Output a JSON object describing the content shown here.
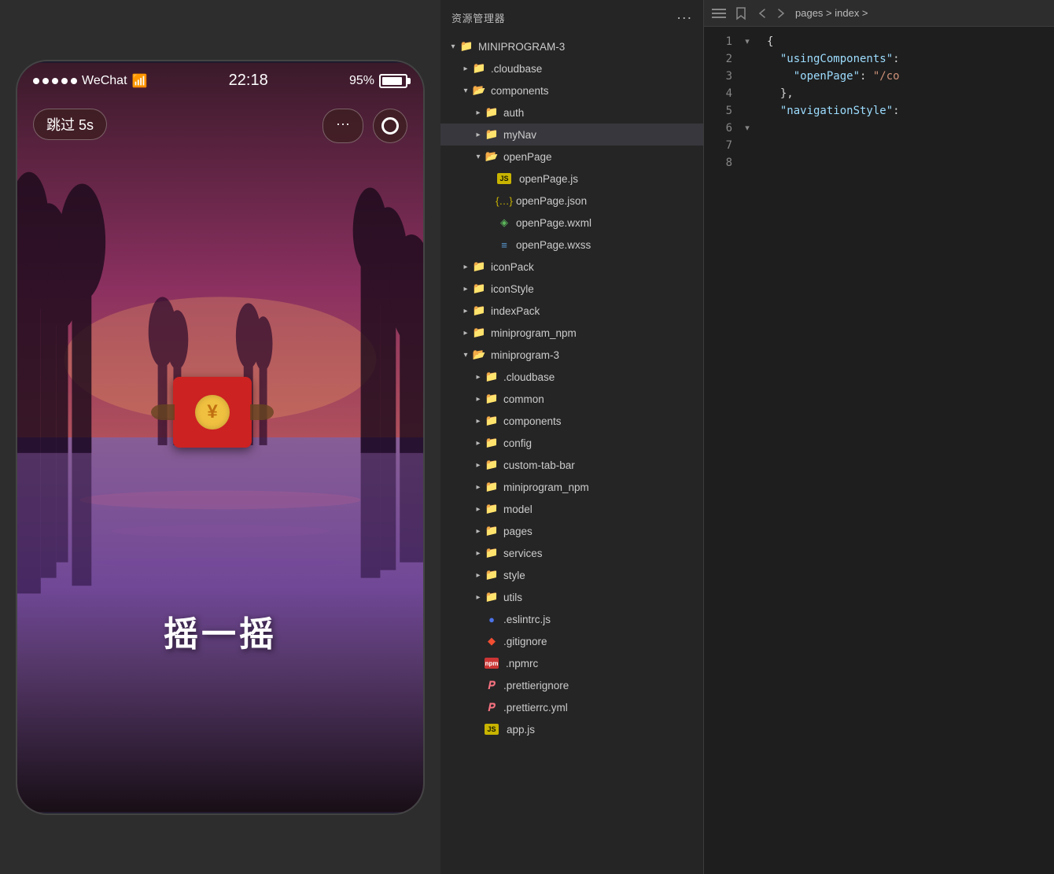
{
  "phone": {
    "status": {
      "dots": [
        1,
        2,
        3,
        4,
        5
      ],
      "app_name": "WeChat",
      "wifi_icon": "wifi",
      "time": "22:18",
      "battery_pct": "95%"
    },
    "skip_btn": "跳过 5s",
    "more_btn": "···",
    "shake_text": "摇一摇",
    "envelope": {
      "yuan_symbol": "¥"
    }
  },
  "explorer": {
    "title": "资源管理器",
    "menu_dots": "···",
    "root": "MINIPROGRAM-3",
    "items": [
      {
        "id": "cloudbase-root",
        "level": 1,
        "type": "folder-closed",
        "color": "blue",
        "label": ".cloudbase"
      },
      {
        "id": "components-root",
        "level": 1,
        "type": "folder-open",
        "color": "yellow",
        "label": "components"
      },
      {
        "id": "auth",
        "level": 2,
        "type": "folder-closed",
        "color": "yellow",
        "label": "auth"
      },
      {
        "id": "myNav",
        "level": 2,
        "type": "folder-closed",
        "color": "yellow",
        "label": "myNav",
        "active": true
      },
      {
        "id": "openPage",
        "level": 2,
        "type": "folder-open",
        "color": "yellow",
        "label": "openPage"
      },
      {
        "id": "openPage-js",
        "level": 3,
        "type": "file",
        "icon": "js",
        "label": "openPage.js"
      },
      {
        "id": "openPage-json",
        "level": 3,
        "type": "file",
        "icon": "json",
        "label": "openPage.json"
      },
      {
        "id": "openPage-wxml",
        "level": 3,
        "type": "file",
        "icon": "wxml",
        "label": "openPage.wxml"
      },
      {
        "id": "openPage-wxss",
        "level": 3,
        "type": "file",
        "icon": "wxss",
        "label": "openPage.wxss"
      },
      {
        "id": "iconPack",
        "level": 1,
        "type": "folder-closed",
        "color": "blue",
        "label": "iconPack"
      },
      {
        "id": "iconStyle",
        "level": 1,
        "type": "folder-closed",
        "color": "blue",
        "label": "iconStyle"
      },
      {
        "id": "indexPack",
        "level": 1,
        "type": "folder-closed",
        "color": "blue",
        "label": "indexPack"
      },
      {
        "id": "miniprogram-npm-root",
        "level": 1,
        "type": "folder-closed",
        "color": "blue",
        "label": "miniprogram_npm"
      },
      {
        "id": "miniprogram-3-dir",
        "level": 1,
        "type": "folder-open",
        "color": "yellow",
        "label": "miniprogram-3"
      },
      {
        "id": "cloudbase-inner",
        "level": 2,
        "type": "folder-closed",
        "color": "blue",
        "label": ".cloudbase"
      },
      {
        "id": "common",
        "level": 2,
        "type": "folder-closed",
        "color": "blue",
        "label": "common"
      },
      {
        "id": "components-inner",
        "level": 2,
        "type": "folder-closed",
        "color": "yellow",
        "label": "components"
      },
      {
        "id": "config",
        "level": 2,
        "type": "folder-closed",
        "color": "teal",
        "label": "config"
      },
      {
        "id": "custom-tab-bar",
        "level": 2,
        "type": "folder-closed",
        "color": "blue",
        "label": "custom-tab-bar"
      },
      {
        "id": "miniprogram-npm-inner",
        "level": 2,
        "type": "folder-closed",
        "color": "blue",
        "label": "miniprogram_npm"
      },
      {
        "id": "model",
        "level": 2,
        "type": "folder-closed",
        "color": "pink",
        "label": "model"
      },
      {
        "id": "pages",
        "level": 2,
        "type": "folder-closed",
        "color": "pink",
        "label": "pages"
      },
      {
        "id": "services",
        "level": 2,
        "type": "folder-closed",
        "color": "yellow",
        "label": "services"
      },
      {
        "id": "style",
        "level": 2,
        "type": "folder-closed",
        "color": "blue",
        "label": "style"
      },
      {
        "id": "utils",
        "level": 2,
        "type": "folder-closed",
        "color": "green",
        "label": "utils"
      },
      {
        "id": "eslintrc",
        "level": 2,
        "type": "file",
        "icon": "eslint",
        "label": ".eslintrc.js"
      },
      {
        "id": "gitignore",
        "level": 2,
        "type": "file",
        "icon": "git",
        "label": ".gitignore"
      },
      {
        "id": "npmrc",
        "level": 2,
        "type": "file",
        "icon": "npm",
        "label": ".npmrc"
      },
      {
        "id": "prettierignore",
        "level": 2,
        "type": "file",
        "icon": "prettier",
        "label": ".prettierignore"
      },
      {
        "id": "prettierrc",
        "level": 2,
        "type": "file",
        "icon": "prettier",
        "label": ".prettierrc.yml"
      },
      {
        "id": "app-js",
        "level": 2,
        "type": "file",
        "icon": "js",
        "label": "app.js"
      }
    ]
  },
  "editor": {
    "breadcrumb": "pages > index >",
    "nav_back": "←",
    "nav_forward": "→",
    "lines": [
      {
        "num": 1,
        "text": "{"
      },
      {
        "num": 2,
        "collapsed": true,
        "text": "  \"usingComponents\":"
      },
      {
        "num": 3,
        "text": ""
      },
      {
        "num": 4,
        "text": "    \"openPage\": \"/co"
      },
      {
        "num": 5,
        "text": ""
      },
      {
        "num": 6,
        "text": "  },"
      },
      {
        "num": 7,
        "text": ""
      },
      {
        "num": 8,
        "text": "  \"navigationStyle\":"
      }
    ]
  }
}
